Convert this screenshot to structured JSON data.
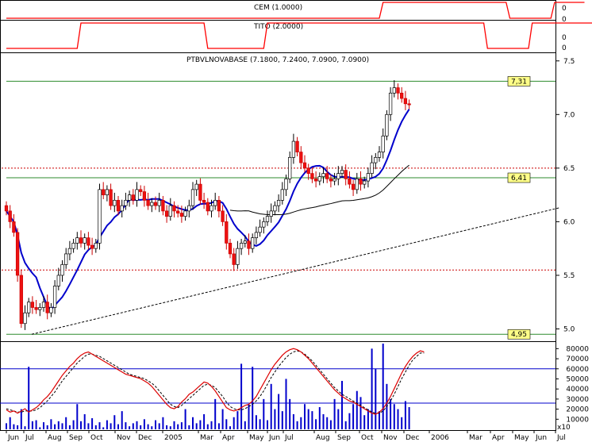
{
  "chart_data": [
    {
      "type": "line",
      "title": "CEM (1.0000)",
      "y_ticks": [
        "0",
        "0"
      ],
      "values": [
        0,
        0,
        0,
        0,
        0,
        0,
        0,
        0,
        0,
        0,
        0,
        0,
        0,
        0,
        0,
        0,
        0,
        0,
        0,
        0,
        0,
        0,
        0,
        0,
        0,
        0,
        0,
        0,
        0,
        0,
        0,
        0,
        0,
        0,
        0,
        0,
        0,
        0,
        0,
        0,
        0,
        0,
        0,
        0,
        0,
        0,
        0,
        0,
        0,
        0,
        0,
        0,
        0,
        0,
        0,
        0,
        0,
        0,
        0,
        0,
        0,
        0,
        0,
        0,
        0,
        0,
        0,
        0,
        0,
        0,
        0,
        0,
        0,
        0,
        0,
        0,
        0,
        0,
        0,
        0,
        0,
        0,
        0,
        0,
        0,
        0,
        0,
        0,
        0,
        0,
        0,
        0,
        0,
        0,
        0,
        0,
        0,
        0,
        0,
        0,
        0,
        1,
        1,
        1,
        1,
        1,
        1,
        1,
        1,
        1,
        1,
        1,
        1,
        1,
        1,
        1,
        1,
        1,
        1,
        1,
        1,
        1,
        1,
        1,
        1,
        1,
        1,
        1,
        1,
        1,
        1,
        1,
        1,
        1,
        1,
        0,
        0,
        0,
        0,
        0,
        0,
        0,
        0,
        0,
        0,
        0,
        0,
        1,
        1,
        1,
        1,
        1,
        1,
        1,
        1,
        1
      ]
    },
    {
      "type": "line",
      "title": "TITO (2.0000)",
      "y_ticks": [
        "0",
        "0"
      ],
      "values": [
        0,
        0,
        0,
        0,
        0,
        0,
        0,
        0,
        0,
        0,
        0,
        0,
        0,
        0,
        0,
        0,
        0,
        0,
        0,
        0,
        1,
        1,
        1,
        1,
        1,
        1,
        1,
        1,
        1,
        1,
        1,
        1,
        1,
        1,
        1,
        1,
        1,
        1,
        1,
        1,
        1,
        1,
        1,
        1,
        1,
        1,
        1,
        1,
        1,
        1,
        1,
        1,
        1,
        1,
        0,
        0,
        0,
        0,
        0,
        0,
        0,
        0,
        0,
        0,
        0,
        0,
        0,
        0,
        0,
        0,
        1,
        1,
        1,
        1,
        1,
        1,
        1,
        1,
        1,
        1,
        1,
        1,
        1,
        1,
        1,
        1,
        1,
        1,
        1,
        1,
        1,
        1,
        1,
        1,
        1,
        1,
        1,
        1,
        1,
        1,
        1,
        1,
        1,
        1,
        1,
        1,
        1,
        1,
        1,
        1,
        1,
        1,
        1,
        1,
        1,
        1,
        1,
        1,
        1,
        1,
        1,
        1,
        1,
        1,
        1,
        1,
        1,
        1,
        1,
        0,
        0,
        0,
        0,
        0,
        0,
        0,
        0,
        0,
        0,
        0,
        0,
        1,
        1,
        1,
        1,
        1,
        1,
        1,
        1,
        1,
        1,
        1,
        1,
        1,
        1,
        1,
        1,
        1,
        1,
        1,
        1,
        1,
        1
      ]
    },
    {
      "type": "candlestick",
      "title": "PTBVLNOVABASE (7.1800, 7.2400, 7.0900, 7.0900)",
      "ylim": [
        4.9,
        7.55
      ],
      "y_ticks": [
        5.0,
        5.5,
        6.0,
        6.5,
        7.0,
        7.5
      ],
      "x_labels": [
        "Jun",
        "Jul",
        "Aug",
        "Sep",
        "Oct",
        "Nov",
        "Dec",
        "2005",
        "Mar",
        "Apr",
        "May",
        "Jun",
        "Jul",
        "Aug",
        "Sep",
        "Oct",
        "Nov",
        "Dec",
        "2006",
        "Mar",
        "Apr",
        "May",
        "Jun",
        "Jul"
      ],
      "x_label_positions": [
        8,
        30,
        58,
        85,
        112,
        145,
        172,
        205,
        250,
        278,
        312,
        337,
        357,
        396,
        423,
        453,
        481,
        509,
        541,
        589,
        618,
        646,
        673,
        700
      ],
      "horizontal_levels": [
        {
          "value": 7.31,
          "label": "7,31"
        },
        {
          "value": 6.41,
          "label": "6,41"
        },
        {
          "value": 4.95,
          "label": "4,95"
        }
      ],
      "dashed_levels": [
        6.5,
        5.55
      ],
      "trendline": {
        "from": [
          40,
          4.95
        ],
        "to": [
          705,
          6.13
        ]
      },
      "bars_x_start": 8,
      "bar_spacing": 4.7,
      "closes": [
        6.1,
        6.0,
        5.9,
        5.5,
        5.05,
        5.15,
        5.25,
        5.2,
        5.18,
        5.2,
        5.25,
        5.15,
        5.2,
        5.4,
        5.5,
        5.6,
        5.7,
        5.75,
        5.8,
        5.85,
        5.8,
        5.85,
        5.78,
        5.75,
        5.8,
        6.3,
        6.25,
        6.3,
        6.15,
        6.2,
        6.1,
        6.15,
        6.2,
        6.25,
        6.2,
        6.3,
        6.28,
        6.2,
        6.15,
        6.18,
        6.15,
        6.2,
        6.1,
        6.05,
        6.15,
        6.1,
        6.08,
        6.05,
        6.1,
        6.15,
        6.3,
        6.35,
        6.2,
        6.18,
        6.1,
        6.15,
        6.2,
        6.1,
        6.0,
        5.8,
        5.7,
        5.6,
        5.75,
        5.8,
        5.82,
        5.75,
        5.85,
        5.9,
        5.95,
        6.0,
        6.05,
        6.1,
        6.15,
        6.2,
        6.3,
        6.4,
        6.6,
        6.75,
        6.65,
        6.55,
        6.5,
        6.45,
        6.4,
        6.38,
        6.42,
        6.45,
        6.4,
        6.38,
        6.4,
        6.45,
        6.48,
        6.4,
        6.35,
        6.3,
        6.4,
        6.35,
        6.38,
        6.45,
        6.55,
        6.6,
        6.65,
        6.8,
        7.0,
        7.2,
        7.25,
        7.2,
        7.15,
        7.1,
        7.09
      ],
      "overlays": [
        {
          "name": "",
          "color": "#0000cc"
        },
        {
          "name": "",
          "color": "#000000"
        }
      ]
    },
    {
      "type": "bar",
      "title": "",
      "ylim": [
        0,
        85000
      ],
      "y_ticks": [
        80000,
        70000,
        60000,
        50000,
        40000,
        30000,
        20000,
        10000
      ],
      "y_tick_labels": [
        "80000",
        "70000",
        "60000",
        "50000",
        "40000",
        "30000",
        "20000",
        "10000"
      ],
      "multiplier_label": "x10",
      "horizontal_levels": [
        60000,
        26000
      ],
      "volume_values": [
        6000,
        12000,
        5000,
        4000,
        20000,
        3000,
        62000,
        8000,
        9000,
        2000,
        7000,
        4000,
        10000,
        5000,
        8000,
        6000,
        12000,
        4000,
        9000,
        25000,
        8000,
        15000,
        6000,
        11000,
        4000,
        7000,
        2000,
        9000,
        6000,
        14000,
        5000,
        18000,
        7000,
        3000,
        6000,
        8000,
        4000,
        10000,
        5000,
        3000,
        9000,
        6000,
        12000,
        4000,
        3000,
        8000,
        5000,
        7000,
        20000,
        4000,
        12000,
        6000,
        9000,
        15000,
        5000,
        8000,
        30000,
        6000,
        20000,
        10000,
        3000,
        12000,
        18000,
        65000,
        8000,
        25000,
        62000,
        14000,
        10000,
        30000,
        9000,
        45000,
        20000,
        35000,
        18000,
        50000,
        30000,
        15000,
        8000,
        12000,
        25000,
        20000,
        18000,
        10000,
        22000,
        15000,
        12000,
        9000,
        30000,
        20000,
        48000,
        8000,
        16000,
        25000,
        38000,
        32000,
        14000,
        20000,
        80000,
        60000,
        18000,
        85000,
        45000,
        30000,
        25000,
        20000,
        12000,
        28000,
        22000
      ],
      "stoch_k": [
        26,
        24,
        25,
        23,
        25,
        27,
        24,
        26,
        28,
        31,
        35,
        38,
        42,
        47,
        52,
        57,
        61,
        65,
        68,
        72,
        75,
        77,
        78,
        76,
        74,
        72,
        70,
        68,
        66,
        64,
        62,
        60,
        58,
        57,
        56,
        55,
        54,
        52,
        50,
        47,
        43,
        39,
        35,
        31,
        28,
        27,
        29,
        33,
        36,
        40,
        42,
        45,
        48,
        51,
        50,
        47,
        43,
        38,
        33,
        28,
        26,
        25,
        26,
        28,
        30,
        31,
        34,
        38,
        44,
        50,
        56,
        62,
        67,
        71,
        75,
        78,
        80,
        81,
        80,
        78,
        75,
        72,
        68,
        64,
        60,
        56,
        52,
        48,
        44,
        41,
        38,
        36,
        34,
        33,
        31,
        29,
        27,
        25,
        23,
        22,
        24,
        27,
        32,
        38,
        45,
        52,
        59,
        65,
        70,
        74,
        77,
        79,
        78
      ],
      "stoch_d": [
        27,
        26,
        25,
        24,
        24,
        25,
        25,
        25,
        26,
        28,
        31,
        34,
        38,
        42,
        47,
        52,
        56,
        60,
        64,
        68,
        71,
        74,
        76,
        76,
        75,
        74,
        72,
        70,
        68,
        66,
        64,
        62,
        60,
        58,
        57,
        56,
        55,
        54,
        52,
        50,
        47,
        43,
        39,
        35,
        31,
        29,
        28,
        30,
        33,
        36,
        39,
        42,
        45,
        48,
        49,
        48,
        46,
        42,
        38,
        33,
        29,
        27,
        26,
        26,
        27,
        29,
        31,
        34,
        38,
        43,
        49,
        55,
        60,
        65,
        69,
        73,
        76,
        78,
        79,
        78,
        76,
        73,
        70,
        66,
        62,
        58,
        54,
        50,
        46,
        43,
        40,
        38,
        36,
        34,
        32,
        30,
        28,
        26,
        24,
        23,
        23,
        25,
        29,
        34,
        40,
        47,
        54,
        60,
        66,
        71,
        74,
        77,
        77
      ]
    }
  ]
}
